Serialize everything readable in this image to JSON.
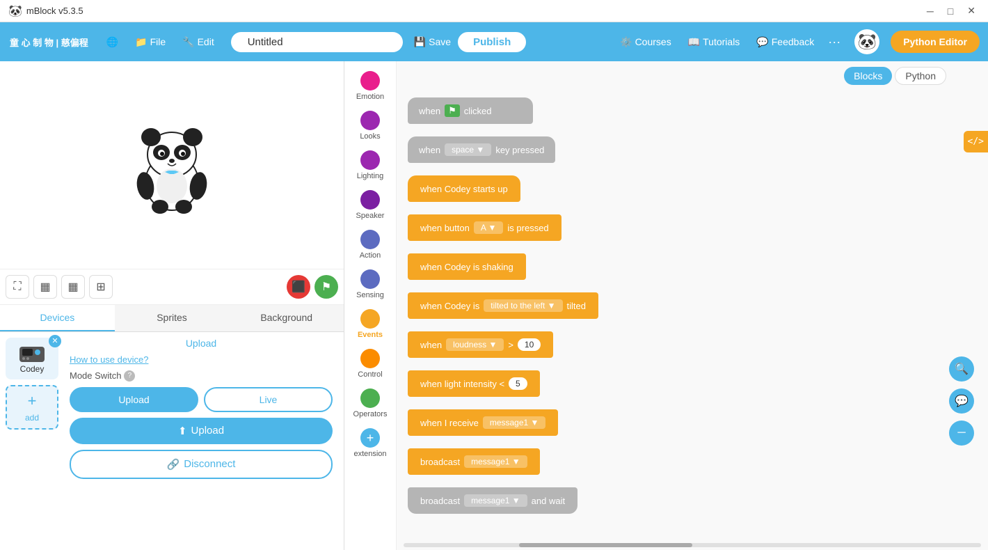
{
  "titleBar": {
    "appName": "mBlock v5.3.5",
    "minimizeLabel": "─",
    "maximizeLabel": "□",
    "closeLabel": "✕"
  },
  "menuBar": {
    "logoText": "童 心 制 物 | 慈偏程",
    "globeIcon": "🌐",
    "fileLabel": "File",
    "editLabel": "Edit",
    "projectName": "Untitled",
    "saveLabel": "💾 Save",
    "publishLabel": "Publish",
    "coursesLabel": "Courses",
    "tutorialsLabel": "Tutorials",
    "feedbackLabel": "Feedback",
    "moreLabel": "···",
    "pandaEmoji": "🐼",
    "pythonEditorLabel": "Python Editor"
  },
  "stageTabs": {
    "devicesLabel": "Devices",
    "spritesLabel": "Sprites",
    "backgroundLabel": "Background"
  },
  "stageControls": {
    "fullscreenIcon": "⛶",
    "gridSmallIcon": "▦",
    "gridMedIcon": "▦",
    "gridLargeIcon": "⊞",
    "stopIcon": "⬛",
    "playIcon": "⚑"
  },
  "deviceSection": {
    "deviceName": "Codey",
    "addLabel": "add",
    "uploadLabel": "Upload",
    "howToUseLabel": "How to use device?",
    "modeSwitchLabel": "Mode Switch",
    "uploadBtnLabel": "Upload",
    "liveBtnLabel": "Live",
    "uploadMainLabel": "Upload",
    "disconnectLabel": "Disconnect"
  },
  "categories": [
    {
      "id": "emotion",
      "label": "Emotion",
      "color": "#e91e8c"
    },
    {
      "id": "looks",
      "label": "Looks",
      "color": "#9c27b0"
    },
    {
      "id": "lighting",
      "label": "Lighting",
      "color": "#9c27b0"
    },
    {
      "id": "speaker",
      "label": "Speaker",
      "color": "#7b1fa2"
    },
    {
      "id": "action",
      "label": "Action",
      "color": "#5c6bc0"
    },
    {
      "id": "sensing",
      "label": "Sensing",
      "color": "#5c6bc0"
    },
    {
      "id": "events",
      "label": "Events",
      "color": "#f5a623",
      "active": true
    },
    {
      "id": "control",
      "label": "Control",
      "color": "#fb8c00"
    },
    {
      "id": "operators",
      "label": "Operators",
      "color": "#4caf50"
    },
    {
      "id": "extension",
      "label": "extension",
      "color": "#4db6e8",
      "isPlus": true
    }
  ],
  "blocksPanel": {
    "blocksTabLabel": "Blocks",
    "pythonTabLabel": "Python",
    "blocks": [
      {
        "id": "when-flag-clicked",
        "type": "gray",
        "text": "when 🏳 clicked"
      },
      {
        "id": "when-key-pressed",
        "type": "gray",
        "text": "when",
        "parts": [
          "space ▼",
          "key pressed"
        ]
      },
      {
        "id": "when-codey-starts",
        "type": "yellow",
        "text": "when Codey starts up"
      },
      {
        "id": "when-button",
        "type": "yellow",
        "text": "when button",
        "parts": [
          "A ▼",
          "is pressed"
        ]
      },
      {
        "id": "when-shaking",
        "type": "yellow",
        "text": "when Codey is shaking"
      },
      {
        "id": "when-tilted",
        "type": "yellow",
        "text": "when Codey is",
        "parts": [
          "tilted to the left ▼",
          "tilted"
        ]
      },
      {
        "id": "when-loudness",
        "type": "yellow",
        "text": "when",
        "parts": [
          "loudness ▼",
          ">",
          "10"
        ]
      },
      {
        "id": "when-light",
        "type": "yellow",
        "text": "when light intensity <",
        "parts": [
          "5"
        ]
      },
      {
        "id": "when-receive",
        "type": "yellow",
        "text": "when I receive",
        "parts": [
          "message1 ▼"
        ]
      },
      {
        "id": "broadcast",
        "type": "yellow",
        "text": "broadcast",
        "parts": [
          "message1 ▼"
        ]
      },
      {
        "id": "broadcast-wait",
        "type": "gray",
        "text": "broadcast",
        "parts": [
          "message1 ▼",
          "and wait"
        ]
      }
    ]
  },
  "rightButtons": {
    "codeToggleLabel": "</>",
    "searchIcon": "🔍",
    "chatIcon": "💬",
    "minusIcon": "─"
  }
}
